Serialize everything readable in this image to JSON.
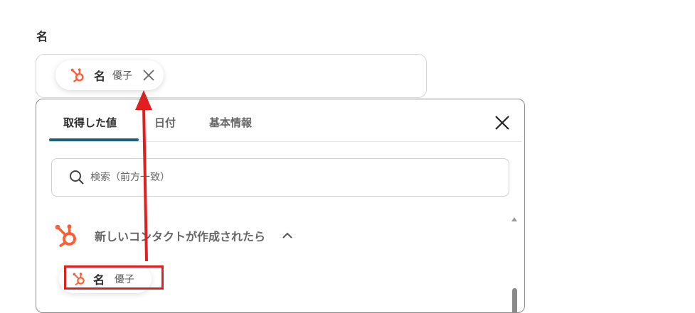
{
  "field": {
    "label": "名"
  },
  "selected_chip": {
    "name": "名",
    "value": "優子",
    "icon": "hubspot-icon",
    "close_icon": "close-icon"
  },
  "tabs": [
    {
      "label": "取得した値",
      "active": true
    },
    {
      "label": "日付",
      "active": false
    },
    {
      "label": "基本情報",
      "active": false
    }
  ],
  "search": {
    "placeholder": "検索（前方一致）",
    "value": ""
  },
  "group": {
    "label": "新しいコンタクトが作成されたら",
    "icon": "hubspot-icon",
    "expanded": true
  },
  "list_items": [
    {
      "name": "名",
      "value": "優子"
    }
  ],
  "colors": {
    "hubspot_orange": "#ff5c35",
    "tab_underline": "#1f5f7a",
    "annotation_red": "#e02020"
  }
}
